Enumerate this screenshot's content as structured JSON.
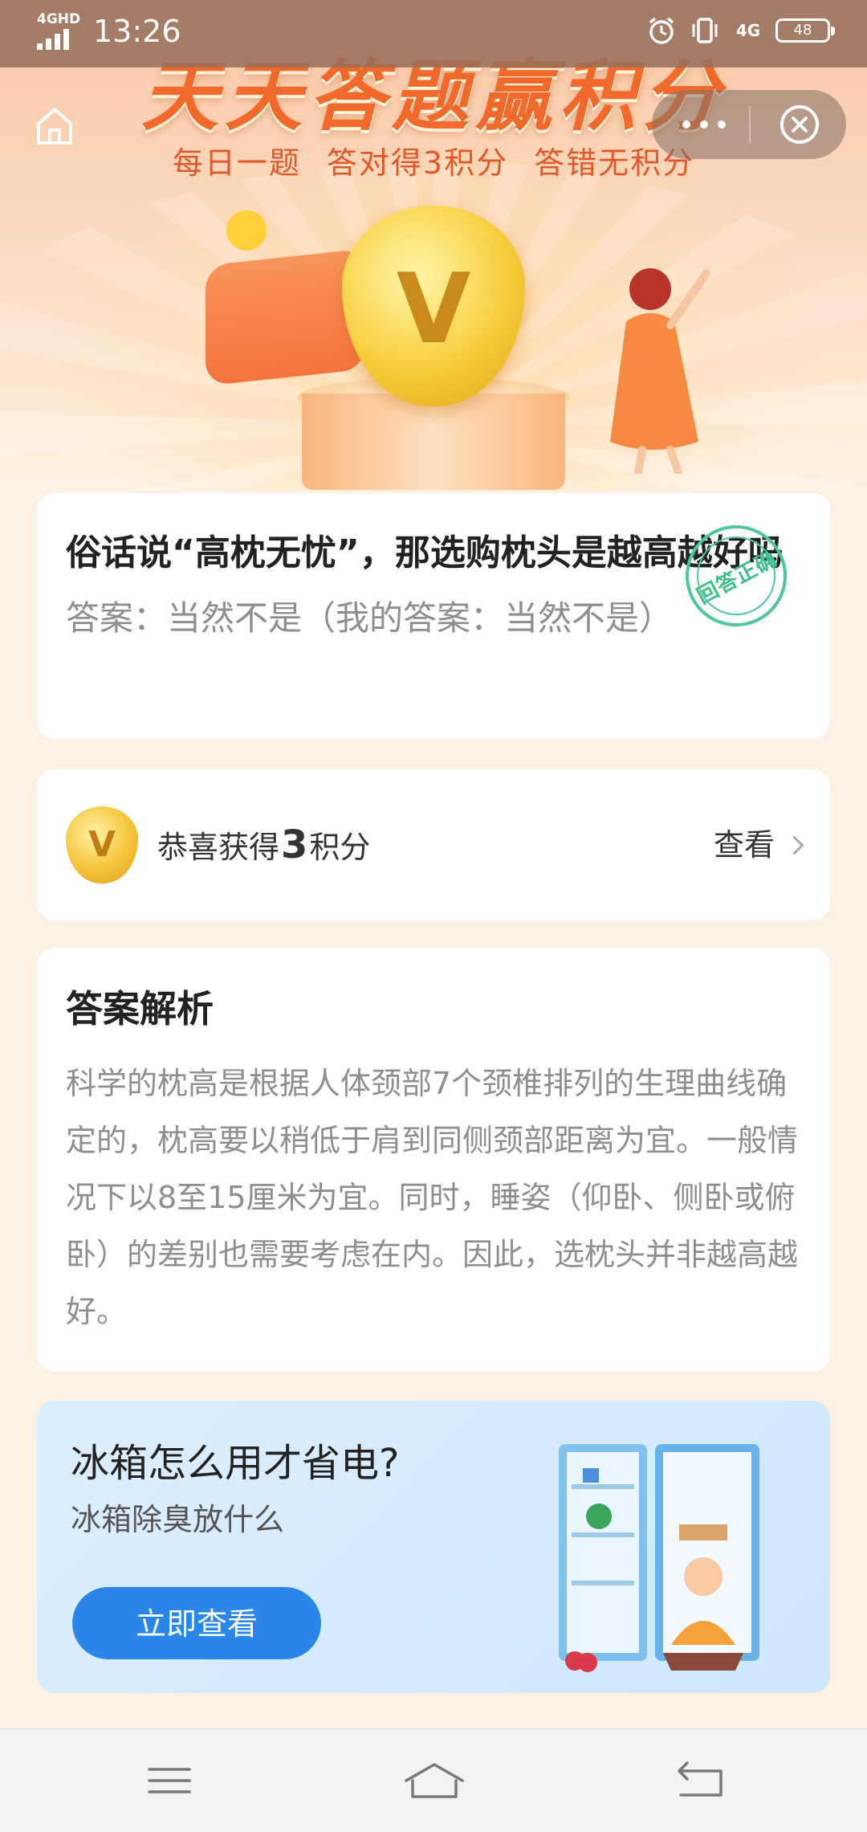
{
  "status_bar": {
    "network": "4GHD",
    "time": "13:26",
    "network_right": "4G",
    "battery": "48",
    "icons": [
      "alarm-icon",
      "vibrate-icon",
      "signal-4g-icon",
      "battery-icon"
    ]
  },
  "hero": {
    "title": "天天答题赢积分",
    "subtitle": "每日一题  答对得3积分  答错无积分"
  },
  "question": {
    "title": "俗话说“高枕无忧”，那选购枕头是越高越好吗",
    "answer": "答案：当然不是（我的答案：当然不是）",
    "stamp": "回答正确"
  },
  "points": {
    "coin_letter": "V",
    "prefix": "恭喜获得",
    "value": "3",
    "suffix": "积分",
    "view": "查看"
  },
  "explanation": {
    "title": "答案解析",
    "body": "科学的枕高是根据人体颈部7个颈椎排列的生理曲线确定的，枕高要以稍低于肩到同侧颈部距离为宜。一般情况下以8至15厘米为宜。同时，睡姿（仰卧、侧卧或俯卧）的差别也需要考虑在内。因此，选枕头并非越高越好。"
  },
  "ad": {
    "title": "冰箱怎么用才省电?",
    "subtitle": "冰箱除臭放什么",
    "button": "立即查看"
  },
  "colors": {
    "accent_orange": "#f16a2c",
    "button_blue": "#2a86e8",
    "stamp_green": "#4dc79c"
  }
}
